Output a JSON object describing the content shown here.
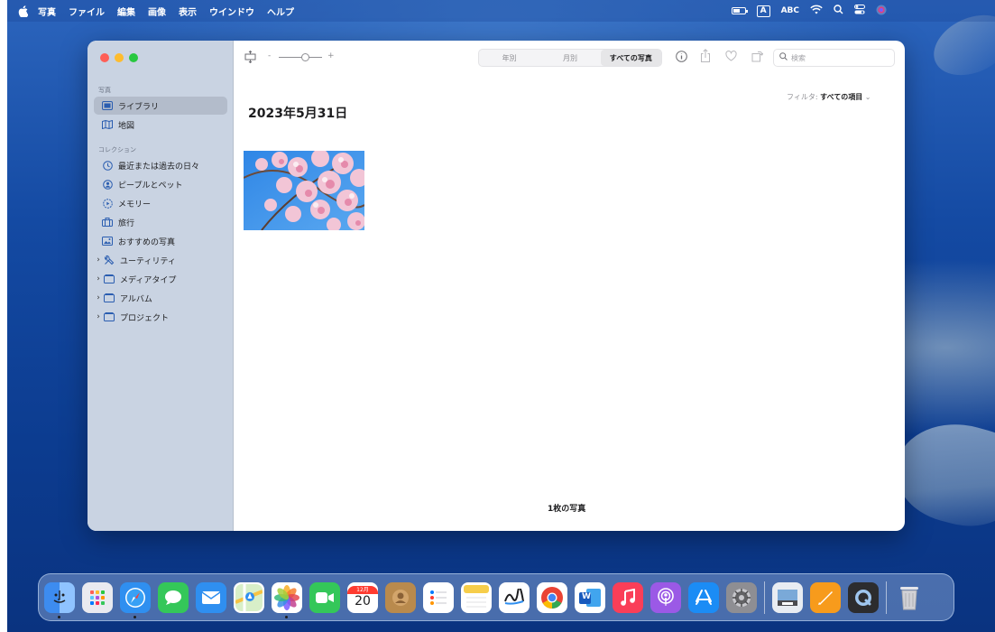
{
  "menubar": {
    "apple": "",
    "items": [
      "写真",
      "ファイル",
      "編集",
      "画像",
      "表示",
      "ウインドウ",
      "ヘルプ"
    ],
    "input_indicator": "A",
    "input_label": "ABC"
  },
  "sidebar": {
    "section_photos": "写真",
    "library": "ライブラリ",
    "map": "地図",
    "section_collections": "コレクション",
    "recent": "最近または過去の日々",
    "people": "ピープルとペット",
    "memories": "メモリー",
    "trips": "旅行",
    "featured": "おすすめの写真",
    "utilities": "ユーティリティ",
    "media_types": "メディアタイプ",
    "albums": "アルバム",
    "projects": "プロジェクト"
  },
  "toolbar": {
    "zoom_minus": "-",
    "zoom_plus": "+",
    "tabs": [
      "年別",
      "月別",
      "すべての写真"
    ],
    "active_tab": "すべての写真",
    "search_placeholder": "検索"
  },
  "main": {
    "filter_label": "フィルタ:",
    "filter_value": "すべての項目",
    "date_title": "2023年5月31日",
    "photo_count": "1枚の写真"
  },
  "dock": {
    "calendar_month": "12月",
    "calendar_day": "20",
    "word_letter": "W"
  },
  "colors": {
    "sidebar_bg": "#c9d3e2",
    "selected_bg": "#b3bccb",
    "accent": "#2a5db0"
  }
}
